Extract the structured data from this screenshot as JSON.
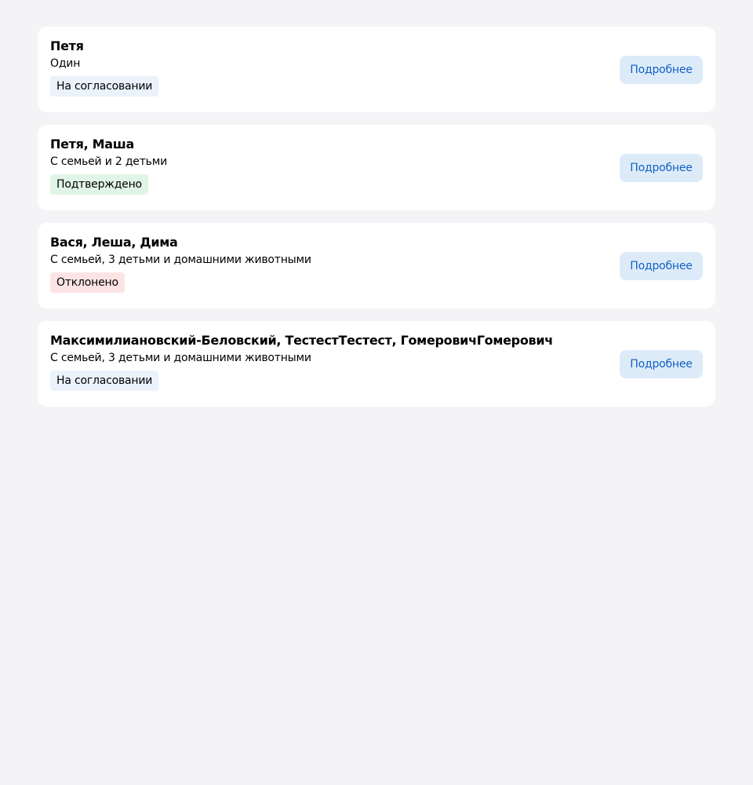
{
  "cards": [
    {
      "names": "Петя",
      "subtitle": "Один",
      "status": "На согласовании",
      "status_kind": "pending",
      "button_label": "Подробнее"
    },
    {
      "names": "Петя, Маша",
      "subtitle": "С семьей и 2 детьми",
      "status": "Подтверждено",
      "status_kind": "approved",
      "button_label": "Подробнее"
    },
    {
      "names": "Вася, Леша, Дима",
      "subtitle": "С семьей, 3 детьми и домашними животными",
      "status": "Отклонено",
      "status_kind": "rejected",
      "button_label": "Подробнее"
    },
    {
      "names": "Максимилиановский-Беловский, ТестестТестест, ГомеровичГомерович",
      "subtitle": "С семьей, 3 детьми и домашними животными",
      "status": "На согласовании",
      "status_kind": "pending",
      "button_label": "Подробнее"
    }
  ],
  "colors": {
    "page_background": "#f4f4f6",
    "card_background": "#ffffff",
    "button_background": "#ddebf9",
    "button_text": "#1261c4",
    "pending_badge": "#eaf2fc",
    "approved_badge": "#e0f5e6",
    "rejected_badge": "#fde4e4"
  }
}
